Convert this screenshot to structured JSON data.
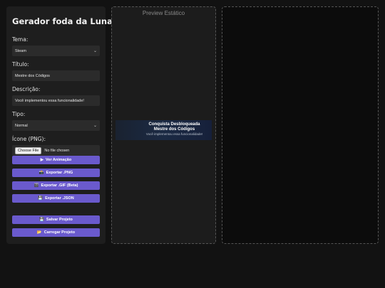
{
  "app": {
    "title": "Gerador foda da Luna"
  },
  "form": {
    "theme_label": "Tema:",
    "theme_value": "Steam",
    "title_label": "Título:",
    "title_value": "Mestre dos Códigos",
    "description_label": "Descrição:",
    "description_value": "Você implementou essa funcionalidade!",
    "type_label": "Tipo:",
    "type_value": "Normal",
    "icon_label": "Ícone (PNG):",
    "file_button": "Choose File",
    "file_status": "No file chosen"
  },
  "actions": {
    "view_animation": {
      "icon": "▶",
      "label": "Ver Animação"
    },
    "export_png": {
      "icon": "📸",
      "label": "Exportar .PNG"
    },
    "export_gif": {
      "icon": "🎬",
      "label": "Exportar .GIF (Beta)"
    },
    "export_json": {
      "icon": "💾",
      "label": "Exportar .JSON"
    },
    "save_project": {
      "icon": "💾",
      "label": "Salvar Projeto"
    },
    "load_project": {
      "icon": "📂",
      "label": "Carregar Projeto"
    }
  },
  "preview": {
    "title": "Preview Estático",
    "badge_heading": "Conquista Desbloqueada",
    "badge_title": "Mestre dos Códigos",
    "badge_description": "Você implementou essa funcionalidade!"
  },
  "colors": {
    "accent": "#6a5acd",
    "page_bg": "#121212"
  }
}
